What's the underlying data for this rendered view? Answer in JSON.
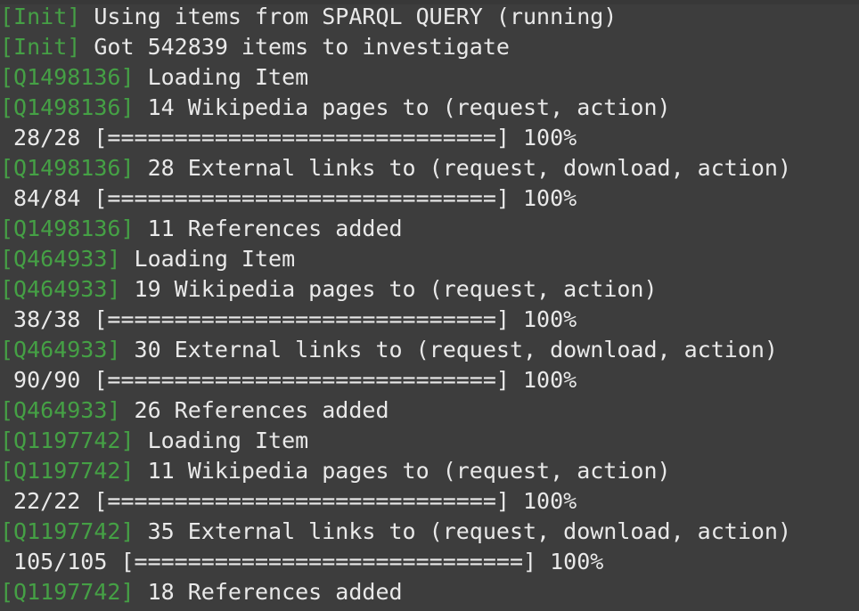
{
  "terminal": {
    "title": "Terminal Output",
    "columns": 62,
    "rows": 19,
    "colors": {
      "background": "#3d3d3d",
      "foreground": "#e9e9e9",
      "tag_green": "#45a045"
    },
    "progress_bar": {
      "fill_char": "=",
      "fill_count": 29,
      "open_bracket": "[",
      "close_bracket": "]",
      "percent_label": "100%"
    }
  },
  "lines": [
    {
      "type": "tagged",
      "tag": "[Init]",
      "message": " Using items from SPARQL QUERY (running)"
    },
    {
      "type": "tagged",
      "tag": "[Init]",
      "message": " Got 542839 items to investigate"
    },
    {
      "type": "tagged",
      "tag": "[Q1498136]",
      "message": " Loading Item"
    },
    {
      "type": "tagged",
      "tag": "[Q1498136]",
      "message": " 14 Wikipedia pages to (request, action)"
    },
    {
      "type": "progress",
      "counter": " 28/28 ",
      "bar": "[=============================]",
      "percent": " 100%"
    },
    {
      "type": "tagged",
      "tag": "[Q1498136]",
      "message": " 28 External links to (request, download, action)"
    },
    {
      "type": "progress",
      "counter": " 84/84 ",
      "bar": "[=============================]",
      "percent": " 100%"
    },
    {
      "type": "tagged",
      "tag": "[Q1498136]",
      "message": " 11 References added"
    },
    {
      "type": "tagged",
      "tag": "[Q464933]",
      "message": " Loading Item"
    },
    {
      "type": "tagged",
      "tag": "[Q464933]",
      "message": " 19 Wikipedia pages to (request, action)"
    },
    {
      "type": "progress",
      "counter": " 38/38 ",
      "bar": "[=============================]",
      "percent": " 100%"
    },
    {
      "type": "tagged",
      "tag": "[Q464933]",
      "message": " 30 External links to (request, download, action)"
    },
    {
      "type": "progress",
      "counter": " 90/90 ",
      "bar": "[=============================]",
      "percent": " 100%"
    },
    {
      "type": "tagged",
      "tag": "[Q464933]",
      "message": " 26 References added"
    },
    {
      "type": "tagged",
      "tag": "[Q1197742]",
      "message": " Loading Item"
    },
    {
      "type": "tagged",
      "tag": "[Q1197742]",
      "message": " 11 Wikipedia pages to (request, action)"
    },
    {
      "type": "progress",
      "counter": " 22/22 ",
      "bar": "[=============================]",
      "percent": " 100%"
    },
    {
      "type": "tagged",
      "tag": "[Q1197742]",
      "message": " 35 External links to (request, download, action)"
    },
    {
      "type": "progress",
      "counter": " 105/105 ",
      "bar": "[=============================]",
      "percent": " 100%"
    },
    {
      "type": "tagged",
      "tag": "[Q1197742]",
      "message": " 18 References added"
    }
  ]
}
